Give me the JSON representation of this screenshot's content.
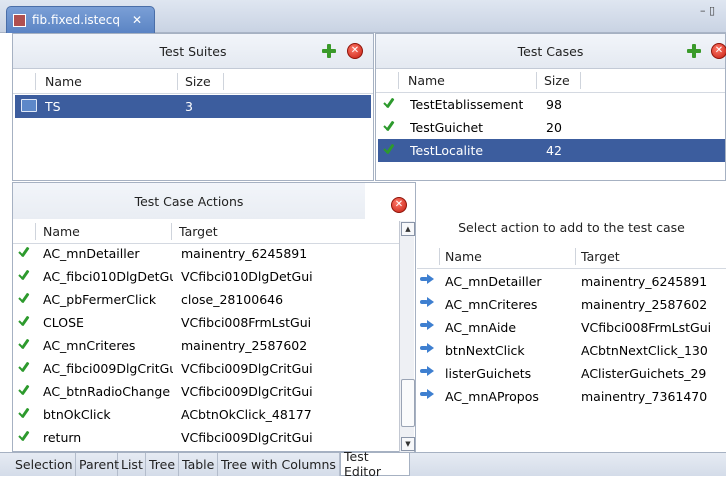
{
  "editor_tab": {
    "title": "fib.fixed.istecq",
    "close_label": "✕"
  },
  "window_controls": {
    "minimize": "–",
    "maximize": "▯"
  },
  "test_suites": {
    "title": "Test Suites",
    "columns": [
      "Name",
      "Size"
    ],
    "rows": [
      {
        "name": "TS",
        "size": "3",
        "selected": true
      }
    ]
  },
  "test_cases": {
    "title": "Test Cases",
    "columns": [
      "Name",
      "Size"
    ],
    "rows": [
      {
        "name": "TestEtablissement",
        "size": "98",
        "selected": false
      },
      {
        "name": "TestGuichet",
        "size": "20",
        "selected": false
      },
      {
        "name": "TestLocalite",
        "size": "42",
        "selected": true
      }
    ]
  },
  "test_case_actions": {
    "title": "Test Case Actions",
    "columns": [
      "Name",
      "Target"
    ],
    "rows": [
      {
        "name": "AC_mnDetailler",
        "target": "mainentry_6245891"
      },
      {
        "name": "AC_fibci010DlgDetGu",
        "target": "VCfibci010DlgDetGui"
      },
      {
        "name": "AC_pbFermerClick",
        "target": "close_28100646"
      },
      {
        "name": "CLOSE",
        "target": "VCfibci008FrmLstGui"
      },
      {
        "name": "AC_mnCriteres",
        "target": "mainentry_2587602"
      },
      {
        "name": "AC_fibci009DlgCritGu",
        "target": "VCfibci009DlgCritGui"
      },
      {
        "name": "AC_btnRadioChange",
        "target": "VCfibci009DlgCritGui"
      },
      {
        "name": "btnOkClick",
        "target": "ACbtnOkClick_48177"
      },
      {
        "name": "return",
        "target": "VCfibci009DlgCritGui"
      }
    ]
  },
  "available_actions": {
    "title": "Select action to add to the test case",
    "columns": [
      "Name",
      "Target"
    ],
    "rows": [
      {
        "name": "AC_mnDetailler",
        "target": "mainentry_6245891"
      },
      {
        "name": "AC_mnCriteres",
        "target": "mainentry_2587602"
      },
      {
        "name": "AC_mnAide",
        "target": "VCfibci008FrmLstGui"
      },
      {
        "name": "btnNextClick",
        "target": "ACbtnNextClick_130"
      },
      {
        "name": "listerGuichets",
        "target": "AClisterGuichets_29"
      },
      {
        "name": "AC_mnAPropos",
        "target": "mainentry_7361470"
      }
    ]
  },
  "scrollbar": {
    "up": "▲",
    "down": "▼"
  },
  "bottom_tabs": [
    {
      "label": "Selection",
      "active": false
    },
    {
      "label": "Parent",
      "active": false
    },
    {
      "label": "List",
      "active": false
    },
    {
      "label": "Tree",
      "active": false
    },
    {
      "label": "Table",
      "active": false
    },
    {
      "label": "Tree with Columns",
      "active": false
    },
    {
      "label": "Test Editor",
      "active": true
    }
  ],
  "colors": {
    "selection": "#3c5d9e",
    "check": "#2d9a2d",
    "tab": "#6a91cf"
  }
}
